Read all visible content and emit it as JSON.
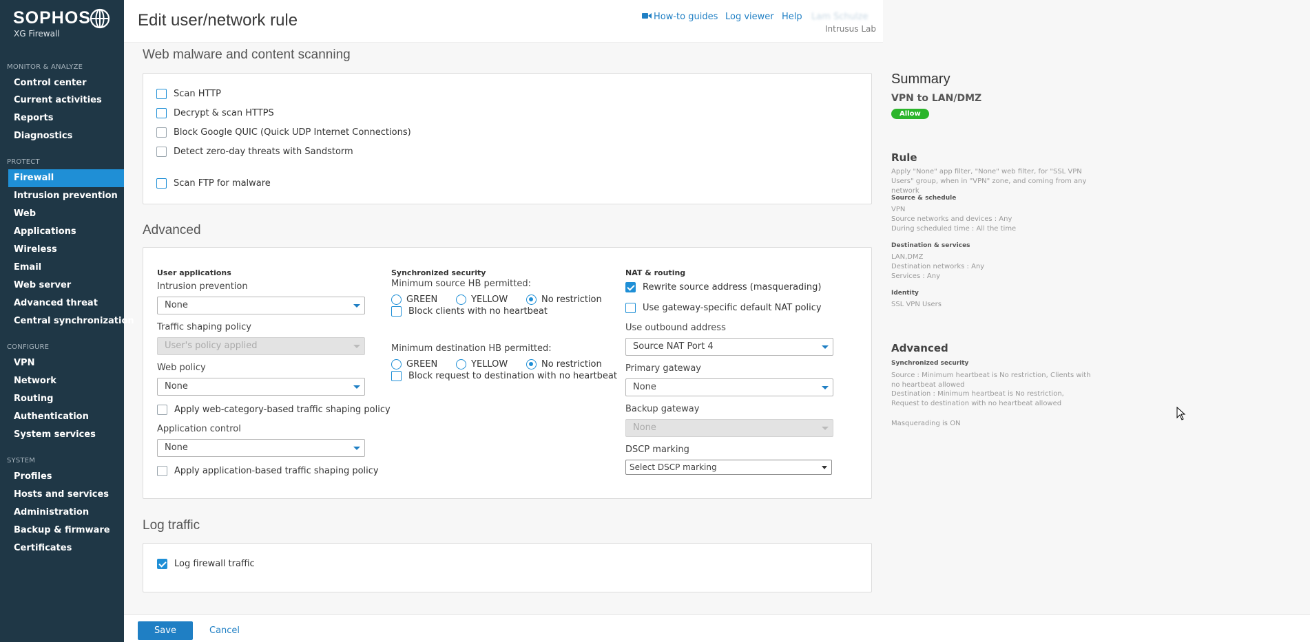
{
  "brand": {
    "name": "SOPHOS",
    "product": "XG Firewall"
  },
  "sidebar": {
    "sections": [
      {
        "label": "MONITOR & ANALYZE",
        "items": [
          "Control center",
          "Current activities",
          "Reports",
          "Diagnostics"
        ]
      },
      {
        "label": "PROTECT",
        "items": [
          "Firewall",
          "Intrusion prevention",
          "Web",
          "Applications",
          "Wireless",
          "Email",
          "Web server",
          "Advanced threat",
          "Central synchronization"
        ]
      },
      {
        "label": "CONFIGURE",
        "items": [
          "VPN",
          "Network",
          "Routing",
          "Authentication",
          "System services"
        ]
      },
      {
        "label": "SYSTEM",
        "items": [
          "Profiles",
          "Hosts and services",
          "Administration",
          "Backup & firmware",
          "Certificates"
        ]
      }
    ],
    "active": "Firewall"
  },
  "header": {
    "title": "Edit user/network rule",
    "how_to": "How-to guides",
    "log_viewer": "Log viewer",
    "help": "Help",
    "user": "Lam Schulze",
    "org": "Intrusus Lab"
  },
  "malware": {
    "title": "Web malware and content scanning",
    "options": [
      {
        "label": "Scan HTTP",
        "checked": false
      },
      {
        "label": "Decrypt & scan HTTPS",
        "checked": false
      },
      {
        "label": "Block Google QUIC (Quick UDP Internet Connections)",
        "checked": false
      },
      {
        "label": "Detect zero-day threats with Sandstorm",
        "checked": false
      },
      {
        "label": "Scan FTP for malware",
        "checked": false
      }
    ]
  },
  "advanced": {
    "title": "Advanced",
    "user_apps": {
      "heading": "User applications",
      "ips_label": "Intrusion prevention",
      "ips_value": "None",
      "shaping_label": "Traffic shaping policy",
      "shaping_value": "User's policy applied",
      "web_label": "Web policy",
      "web_value": "None",
      "web_shaping": "Apply web-category-based traffic shaping policy",
      "app_label": "Application control",
      "app_value": "None",
      "app_shaping": "Apply application-based traffic shaping policy"
    },
    "sync": {
      "heading": "Synchronized security",
      "src_label": "Minimum source HB permitted:",
      "dst_label": "Minimum destination HB permitted:",
      "green": "GREEN",
      "yellow": "YELLOW",
      "none": "No restriction",
      "selected": "No restriction",
      "block_clients": "Block clients with no heartbeat",
      "block_dest": "Block request to destination with no heartbeat"
    },
    "nat": {
      "heading": "NAT & routing",
      "masq": "Rewrite source address (masquerading)",
      "masq_checked": true,
      "gw_nat": "Use gateway-specific default NAT policy",
      "gw_nat_checked": false,
      "outbound_label": "Use outbound address",
      "outbound_value": "Source NAT Port 4",
      "primary_label": "Primary gateway",
      "primary_value": "None",
      "backup_label": "Backup gateway",
      "backup_value": "None",
      "dscp_label": "DSCP marking",
      "dscp_value": "Select DSCP marking"
    }
  },
  "log": {
    "title": "Log traffic",
    "option": "Log firewall traffic",
    "checked": true
  },
  "summary": {
    "title": "Summary",
    "rule_name": "VPN to LAN/DMZ",
    "action": "Allow",
    "rule_heading": "Rule",
    "rule_desc": "Apply \"None\" app filter, \"None\" web filter, for \"SSL VPN Users\" group, when in \"VPN\" zone, and coming from any network",
    "source_heading": "Source & schedule",
    "source_lines": [
      "VPN",
      "Source networks and devices : Any",
      "During scheduled time : All the time"
    ],
    "dest_heading": "Destination & services",
    "dest_lines": [
      "LAN,DMZ",
      "Destination networks : Any",
      "Services : Any"
    ],
    "identity_heading": "Identity",
    "identity_lines": [
      "SSL VPN Users"
    ],
    "adv_heading": "Advanced",
    "sync_heading": "Synchronized security",
    "sync_src": "Source : Minimum heartbeat is No restriction, Clients with no heartbeat allowed",
    "sync_dst": "Destination : Minimum heartbeat is No restriction, Request to destination with no heartbeat allowed",
    "masq": "Masquerading is ON"
  },
  "footer": {
    "save": "Save",
    "cancel": "Cancel"
  },
  "colors": {
    "sidebar": "#1f3746",
    "accent": "#1f8fd6",
    "allow": "#2bb52b"
  }
}
